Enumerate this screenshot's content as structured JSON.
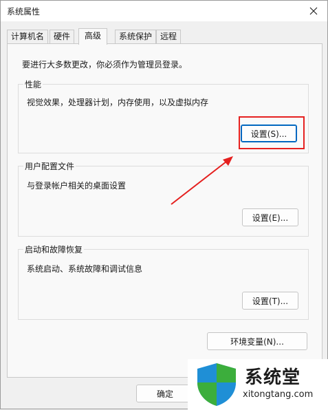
{
  "window": {
    "title": "系统属性",
    "close_icon": "close-icon"
  },
  "tabs": [
    {
      "label": "计算机名",
      "active": false
    },
    {
      "label": "硬件",
      "active": false
    },
    {
      "label": "高级",
      "active": true
    },
    {
      "label": "系统保护",
      "active": false
    },
    {
      "label": "远程",
      "active": false
    }
  ],
  "panel": {
    "notice": "要进行大多数更改，你必须作为管理员登录。",
    "performance": {
      "title": "性能",
      "description": "视觉效果，处理器计划，内存使用，以及虚拟内存",
      "button": "设置(S)..."
    },
    "user_profiles": {
      "title": "用户配置文件",
      "description": "与登录帐户相关的桌面设置",
      "button": "设置(E)..."
    },
    "startup_recovery": {
      "title": "启动和故障恢复",
      "description": "系统启动、系统故障和调试信息",
      "button": "设置(T)..."
    },
    "env_button": "环境变量(N)..."
  },
  "footer": {
    "ok_button": "确定"
  },
  "annotation": {
    "highlight_color": "#e5201f"
  },
  "watermark": {
    "brand": "系统堂",
    "url": "xitongtang.com",
    "shield_colors": [
      "#1f8fd6",
      "#3cae3c"
    ]
  }
}
